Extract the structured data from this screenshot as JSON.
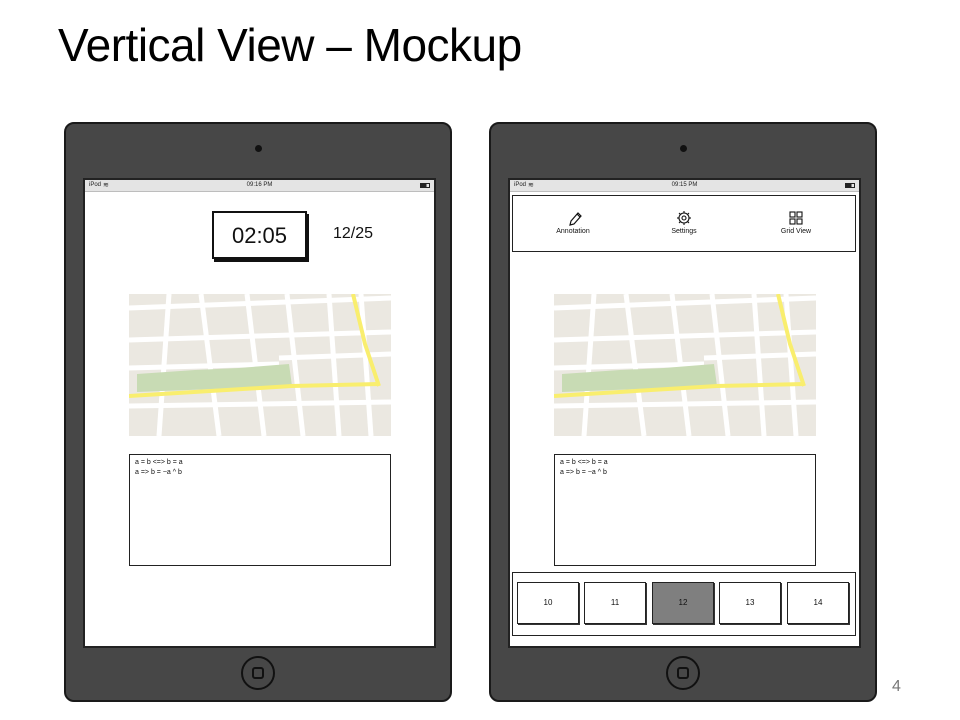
{
  "slide": {
    "title": "Vertical View – Mockup",
    "page_number": "4"
  },
  "left_device": {
    "statusbar": {
      "device": "iPod",
      "time": "09:16 PM"
    },
    "timer": "02:05",
    "page_counter": "12/25",
    "formulas": [
      "a = b <=> b = a",
      "a => b = ~a ^ b"
    ]
  },
  "right_device": {
    "statusbar": {
      "device": "iPod",
      "time": "09:15 PM"
    },
    "toolbar": [
      {
        "label": "Annotation",
        "icon": "pencil-icon"
      },
      {
        "label": "Settings",
        "icon": "gear-icon"
      },
      {
        "label": "Grid View",
        "icon": "grid-icon"
      }
    ],
    "formulas": [
      "a = b <=> b = a",
      "a => b = ~a ^ b"
    ],
    "pages": [
      "10",
      "11",
      "12",
      "13",
      "14"
    ],
    "active_page": "12"
  },
  "colors": {
    "device_body": "#474747",
    "map_background": "#ebe8e1",
    "map_park": "#c8dbb4",
    "map_highway": "#f9ee6e",
    "active_thumb": "#7f7f7f"
  }
}
